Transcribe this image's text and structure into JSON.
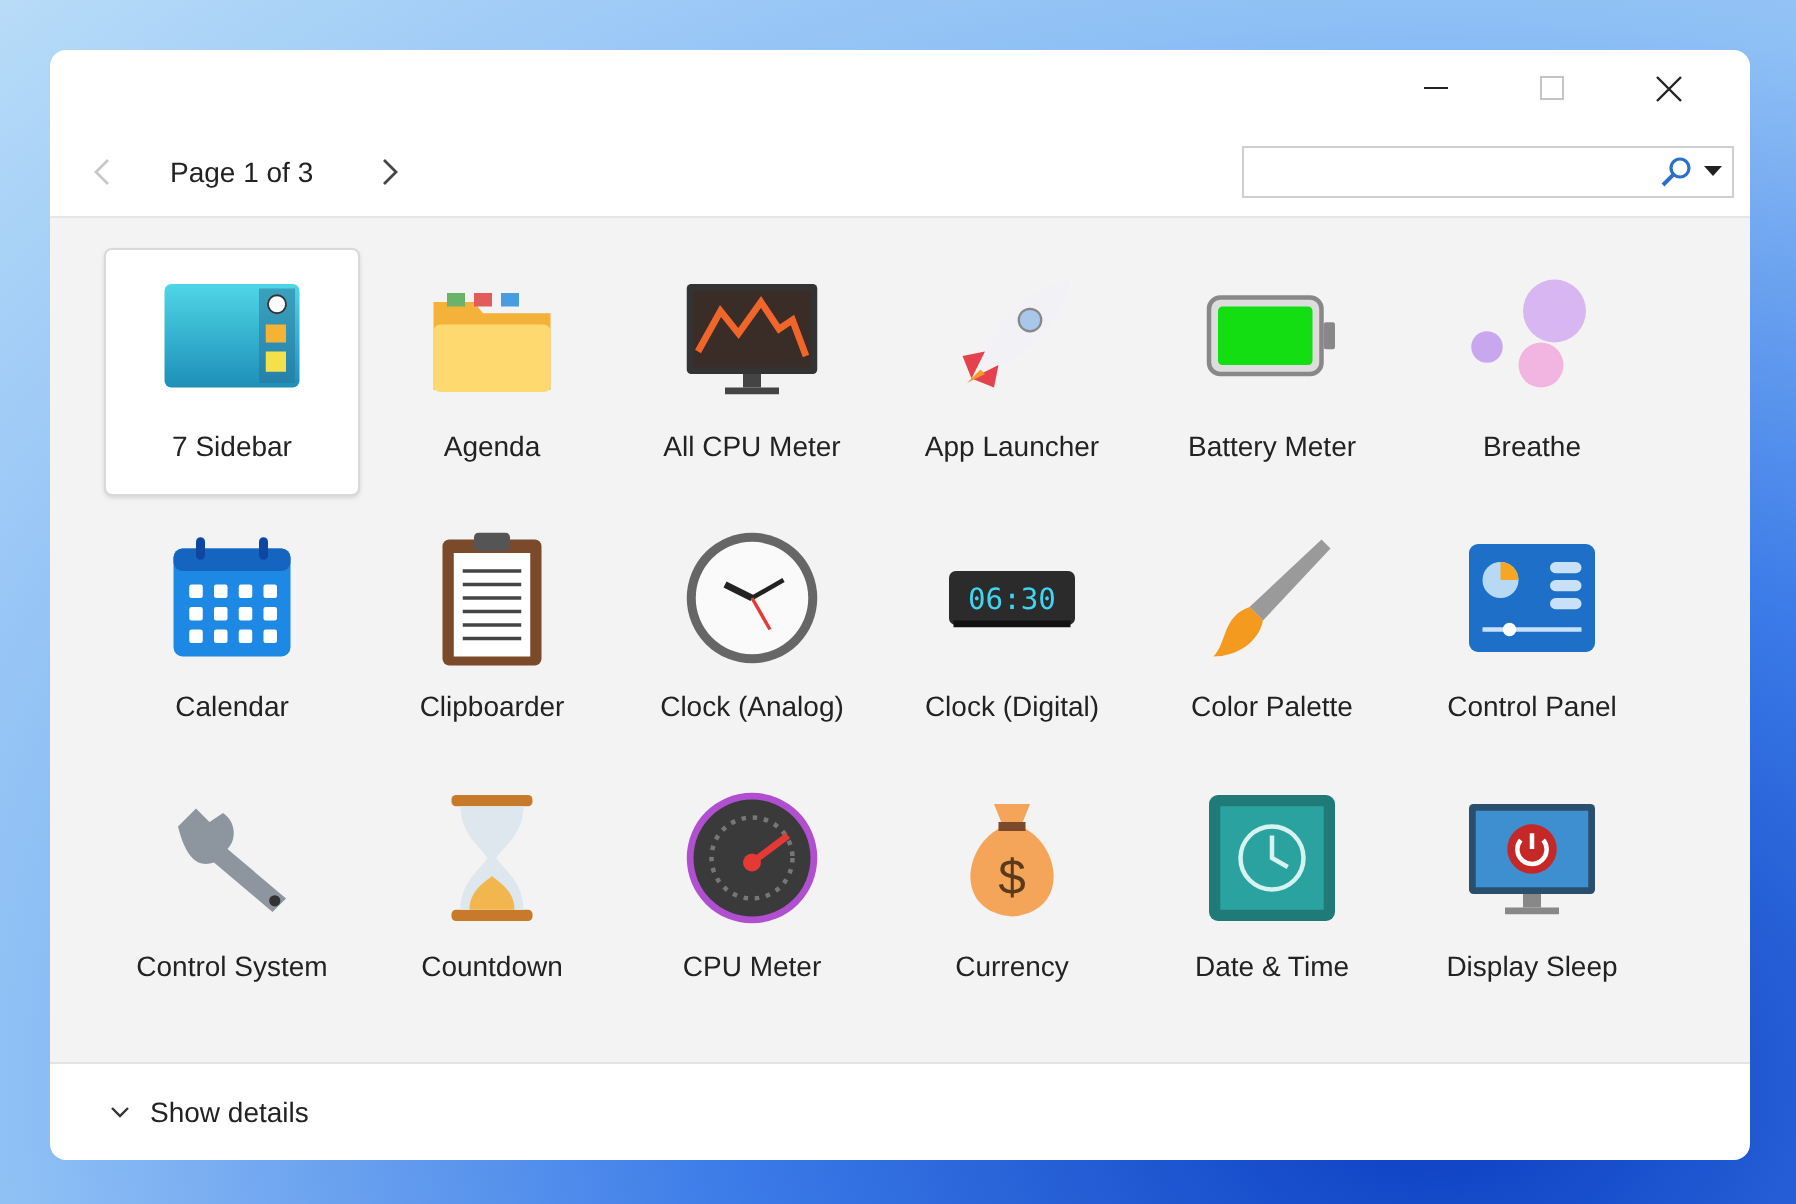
{
  "window_controls": [
    {
      "kind": "minimize",
      "disabled": false
    },
    {
      "kind": "maximize",
      "disabled": true
    },
    {
      "kind": "close",
      "disabled": false
    }
  ],
  "toolbar": {
    "back_disabled": true,
    "forward_disabled": false,
    "page_label": "Page 1 of 3"
  },
  "gadgets": [
    {
      "label": "7 Sidebar",
      "selected": true
    },
    {
      "label": "Agenda",
      "selected": false
    },
    {
      "label": "All CPU Meter",
      "selected": false
    },
    {
      "label": "App Launcher",
      "selected": false
    },
    {
      "label": "Battery Meter",
      "selected": false
    },
    {
      "label": "Breathe",
      "selected": false
    },
    {
      "label": "Calendar",
      "selected": false
    },
    {
      "label": "Clipboarder",
      "selected": false
    },
    {
      "label": "Clock (Analog)",
      "selected": false
    },
    {
      "label": "Clock (Digital)",
      "selected": false,
      "display": "06:30"
    },
    {
      "label": "Color Palette",
      "selected": false
    },
    {
      "label": "Control Panel",
      "selected": false
    },
    {
      "label": "Control System",
      "selected": false
    },
    {
      "label": "Countdown",
      "selected": false
    },
    {
      "label": "CPU Meter",
      "selected": false
    },
    {
      "label": "Currency",
      "selected": false,
      "display": "$"
    },
    {
      "label": "Date & Time",
      "selected": false
    },
    {
      "label": "Display Sleep",
      "selected": false
    }
  ],
  "footer": {
    "label": "Show details",
    "expanded": false
  }
}
